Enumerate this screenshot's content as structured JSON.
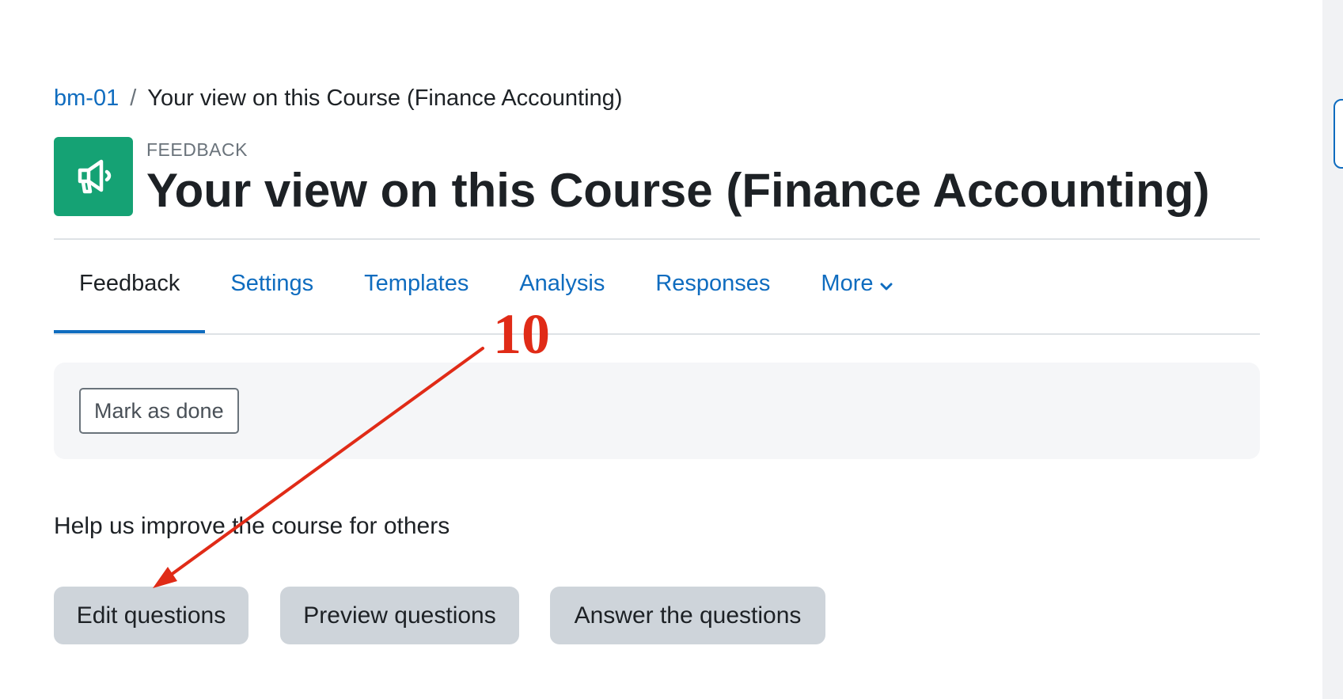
{
  "breadcrumb": {
    "course_link": "bm-01",
    "separator": "/",
    "current": "Your view on this Course (Finance Accounting)"
  },
  "header": {
    "activity_icon": "megaphone-icon",
    "activity_icon_color": "#15a274",
    "module_type": "FEEDBACK",
    "title": "Your view on this Course (Finance Accounting)"
  },
  "tabs": [
    {
      "label": "Feedback",
      "active": true
    },
    {
      "label": "Settings",
      "active": false
    },
    {
      "label": "Templates",
      "active": false
    },
    {
      "label": "Analysis",
      "active": false
    },
    {
      "label": "Responses",
      "active": false
    },
    {
      "label": "More",
      "active": false,
      "icon": "chevron-down-icon"
    }
  ],
  "completion": {
    "mark_done_label": "Mark as done"
  },
  "main": {
    "intro": "Help us improve the course for others",
    "buttons": {
      "edit": "Edit questions",
      "preview": "Preview questions",
      "answer": "Answer the questions"
    }
  },
  "annotation": {
    "step_number": "10",
    "color": "#e02b17",
    "arrow_target": "edit-questions-button"
  },
  "colors": {
    "link": "#0f6cbf",
    "text": "#1d2125",
    "button_bg": "#ced4da",
    "panel_bg": "#f5f6f8"
  }
}
